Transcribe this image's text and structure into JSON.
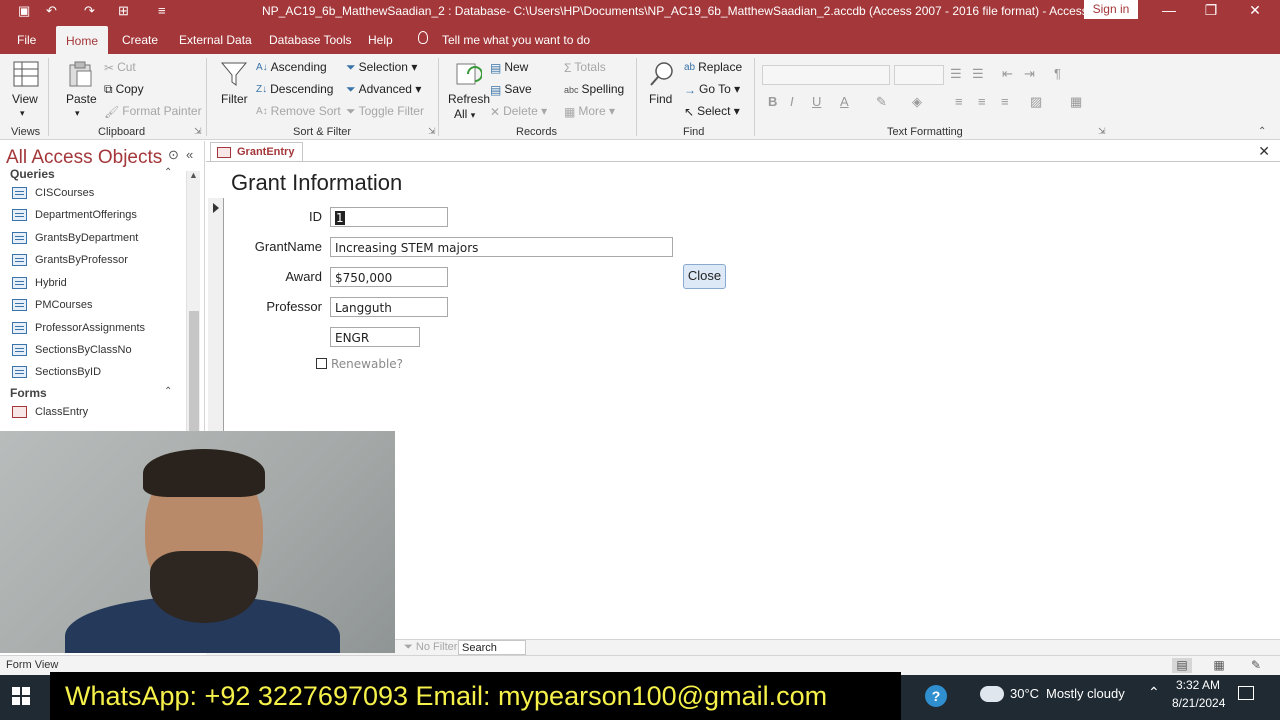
{
  "window": {
    "title": "NP_AC19_6b_MatthewSaadian_2 : Database- C:\\Users\\HP\\Documents\\NP_AC19_6b_MatthewSaadian_2.accdb (Access 2007 - 2016 file format)  -  Access",
    "sign_in": "Sign in"
  },
  "tabs": [
    "File",
    "Home",
    "Create",
    "External Data",
    "Database Tools",
    "Help",
    "Tell me what you want to do"
  ],
  "ribbon": {
    "views": {
      "view": "View",
      "group": "Views"
    },
    "clipboard": {
      "paste": "Paste",
      "cut": "Cut",
      "copy": "Copy",
      "format_painter": "Format Painter",
      "group": "Clipboard"
    },
    "sort_filter": {
      "filter": "Filter",
      "ascending": "Ascending",
      "descending": "Descending",
      "remove_sort": "Remove Sort",
      "selection": "Selection",
      "advanced": "Advanced",
      "toggle_filter": "Toggle Filter",
      "group": "Sort & Filter"
    },
    "records": {
      "refresh": "Refresh",
      "refresh_all": "All",
      "new": "New",
      "save": "Save",
      "delete": "Delete",
      "totals": "Totals",
      "spelling": "Spelling",
      "more": "More",
      "group": "Records"
    },
    "find": {
      "find": "Find",
      "replace": "Replace",
      "go_to": "Go To",
      "select": "Select",
      "group": "Find"
    },
    "text_formatting": {
      "group": "Text Formatting"
    }
  },
  "nav": {
    "title": "All Access Objects",
    "queries_label": "Queries",
    "queries": [
      "CISCourses",
      "DepartmentOfferings",
      "GrantsByDepartment",
      "GrantsByProfessor",
      "Hybrid",
      "PMCourses",
      "ProfessorAssignments",
      "SectionsByClassNo",
      "SectionsByID"
    ],
    "forms_label": "Forms",
    "forms": [
      "ClassEntry"
    ]
  },
  "document": {
    "tab": "GrantEntry",
    "form_title": "Grant Information",
    "fields": {
      "id_label": "ID",
      "id_value": "1",
      "grantname_label": "GrantName",
      "grantname_value": "Increasing STEM majors",
      "award_label": "Award",
      "award_value": "$750,000",
      "professor_label": "Professor",
      "professor_value": "Langguth",
      "department_value": "ENGR",
      "renewable_label": "Renewable?"
    },
    "close_button": "Close"
  },
  "record_nav": {
    "no_filter": "No Filter",
    "search": "Search"
  },
  "status": {
    "text": "Form View"
  },
  "banner": {
    "text": "WhatsApp: +92 3227697093  Email: mypearson100@gmail.com"
  },
  "taskbar": {
    "temperature": "30°C",
    "weather": "Mostly cloudy",
    "time": "3:32 AM",
    "date": "8/21/2024"
  }
}
